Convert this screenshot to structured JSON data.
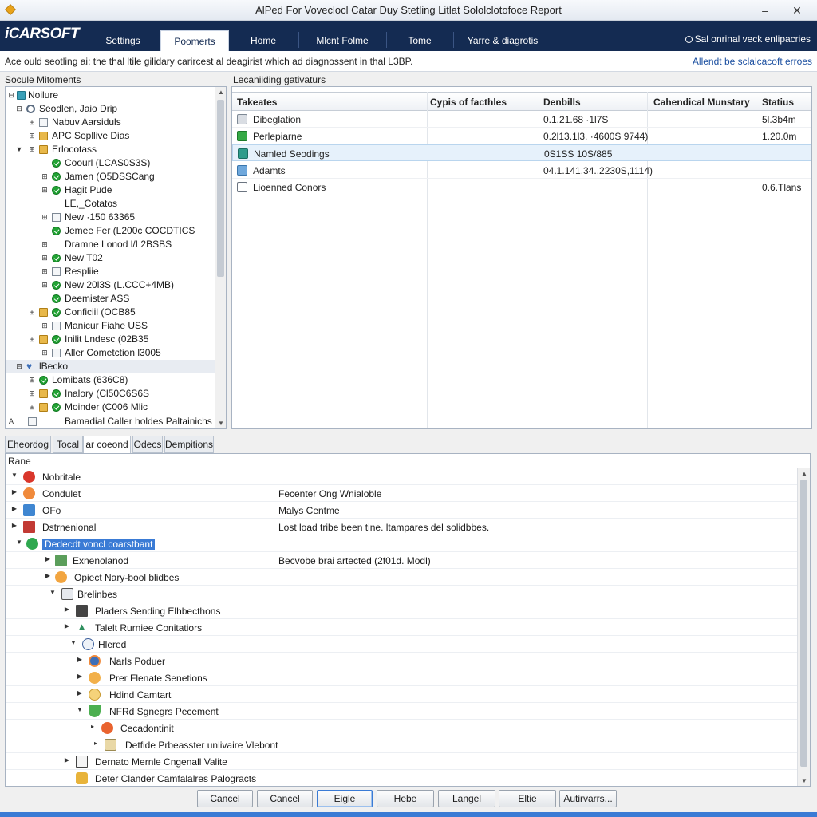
{
  "window": {
    "title": "AlPed For Voveclocl Catar Duy Stetling Litlat Sololclotofoce Report",
    "minimize": "–",
    "close": "✕"
  },
  "brand": {
    "name": "iCARSOFT",
    "tabs": [
      "Settings",
      "Poomerts",
      "Home",
      "Mlcnt Folme",
      "Tome",
      "Yarre & diagrotis"
    ],
    "active_tab_index": 1,
    "right_text": "Sal onrinal veck enlipacries"
  },
  "info": {
    "message": "Ace ould seotling ai: the thal ltile gilidary carircest al deagirist which ad diagnossent in thal L3BP.",
    "link": "Allendt be sclalcacoft erroes"
  },
  "left_panel": {
    "label": "Socule Mitoments",
    "items": [
      {
        "label": "Noilure",
        "icon": "folder-icon"
      },
      {
        "label": "Seodlen, Jaio Drip",
        "icon": "gear-icon"
      },
      {
        "label": "Nabuv Aarsiduls",
        "icon": "folder-icon"
      },
      {
        "label": "APC Sopllive Dias",
        "icon": "folder-icon"
      },
      {
        "label": "Erlocotass",
        "icon": "folder-icon"
      },
      {
        "label": "Coourl (LCAS0S3S)",
        "icon": "check-icon"
      },
      {
        "label": "Jamen (O5DSSCang",
        "icon": "check-icon"
      },
      {
        "label": "Hagit Pude",
        "icon": "check-icon"
      },
      {
        "label": "LE,_Cotatos",
        "icon": "doc-icon"
      },
      {
        "label": "New ·150 63365",
        "icon": "doc-icon"
      },
      {
        "label": "Jemee Fer (L200c COCDTICS",
        "icon": "check-icon"
      },
      {
        "label": "Dramne Lonod l/L2BSBS",
        "icon": "doc-icon"
      },
      {
        "label": "New T02",
        "icon": "check-icon"
      },
      {
        "label": "Respliie",
        "icon": "doc-icon"
      },
      {
        "label": "New 20l3S (L.CCC+4MB)",
        "icon": "check-icon"
      },
      {
        "label": "Deemister ASS",
        "icon": "check-icon"
      },
      {
        "label": "Conficiil (OCB85",
        "icon": "folder-icon"
      },
      {
        "label": "Manicur Fiahe USS",
        "icon": "doc-icon"
      },
      {
        "label": "Inilit Lndesc (02B35",
        "icon": "folder-icon"
      },
      {
        "label": "Aller Cometction l3005",
        "icon": "doc-icon"
      },
      {
        "label": "lBecko",
        "icon": "heart-icon"
      },
      {
        "label": "Lomibats (636C8)",
        "icon": "check-icon"
      },
      {
        "label": "Inalory (Cl50C6S6S",
        "icon": "folder-icon"
      },
      {
        "label": "Moinder (C006 Mlic",
        "icon": "folder-icon"
      },
      {
        "label": "Bamadial Caller holdes Paltainichs",
        "icon": "doc-icon"
      }
    ]
  },
  "right_panel": {
    "label": "Lecaniiding gativaturs",
    "columns": [
      "Takeates",
      "Cypis of facthles",
      "Denbills",
      "Cahendical Munstary",
      "Statius"
    ],
    "rows": [
      {
        "name": "Dibeglation",
        "type": "",
        "details": "0.1.21.68 ·1l7S",
        "summary": "",
        "status": "5l.3b4m"
      },
      {
        "name": "Perlepiarne",
        "type": "",
        "details": "0.2l13.1l3. ·4600S 9744)",
        "summary": "",
        "status": "1.20.0m"
      },
      {
        "name": "Namled Seodings",
        "type": "",
        "details": "0S1SS 10S/885",
        "summary": "",
        "status": ""
      },
      {
        "name": "Adamts",
        "type": "",
        "details": "04.1.141.34..2230S,1114)",
        "summary": "",
        "status": ""
      },
      {
        "name": "Lioenned Conors",
        "type": "",
        "details": "",
        "summary": "",
        "status": "0.6.Tlans"
      }
    ],
    "selected_index": 2
  },
  "sub_tabs": {
    "items": [
      "Eheordog",
      "Tocal",
      "ar coeond",
      "Odecs",
      "Dempitions"
    ],
    "active_index": 2
  },
  "lower_panel": {
    "label": "Rane",
    "rows": [
      {
        "label": "Nobritale",
        "value": ""
      },
      {
        "label": "Condulet",
        "value": "Fecenter Ong Wnialoble"
      },
      {
        "label": "OFo",
        "value": "Malys Centme"
      },
      {
        "label": "Dstrnenional",
        "value": "Lost load tribe been tine. ltampares del solidbbes."
      },
      {
        "label": "Dedecdt voncl coarstbant",
        "value": ""
      },
      {
        "label": "Exnenolanod",
        "value": "Becvobe brai artected (2f01d. Modl)"
      },
      {
        "label": "Opiect Nary-bool blidbes",
        "value": ""
      },
      {
        "label": "Brelinbes",
        "value": ""
      },
      {
        "label": "Pladers Sending Elhbecthons",
        "value": ""
      },
      {
        "label": "Talelt Rurniee Conitatiors",
        "value": ""
      },
      {
        "label": "Hlered",
        "value": ""
      },
      {
        "label": "Narls Poduer",
        "value": ""
      },
      {
        "label": "Prer Flenate Senetions",
        "value": ""
      },
      {
        "label": "Hdind Camtart",
        "value": ""
      },
      {
        "label": "NFRd Sgnegrs Pecement",
        "value": ""
      },
      {
        "label": "Cecadontinit",
        "value": ""
      },
      {
        "label": "Detfide Prbeasster unlivaire Vlebont",
        "value": ""
      },
      {
        "label": "Dernato Mernle Cngenall Valite",
        "value": ""
      },
      {
        "label": "Deter Clander Camfalalres Palogracts",
        "value": ""
      }
    ]
  },
  "buttons": [
    "Cancel",
    "Cancel",
    "Eigle",
    "Hebe",
    "Langel",
    "Eltie",
    "Autirvarrs..."
  ]
}
